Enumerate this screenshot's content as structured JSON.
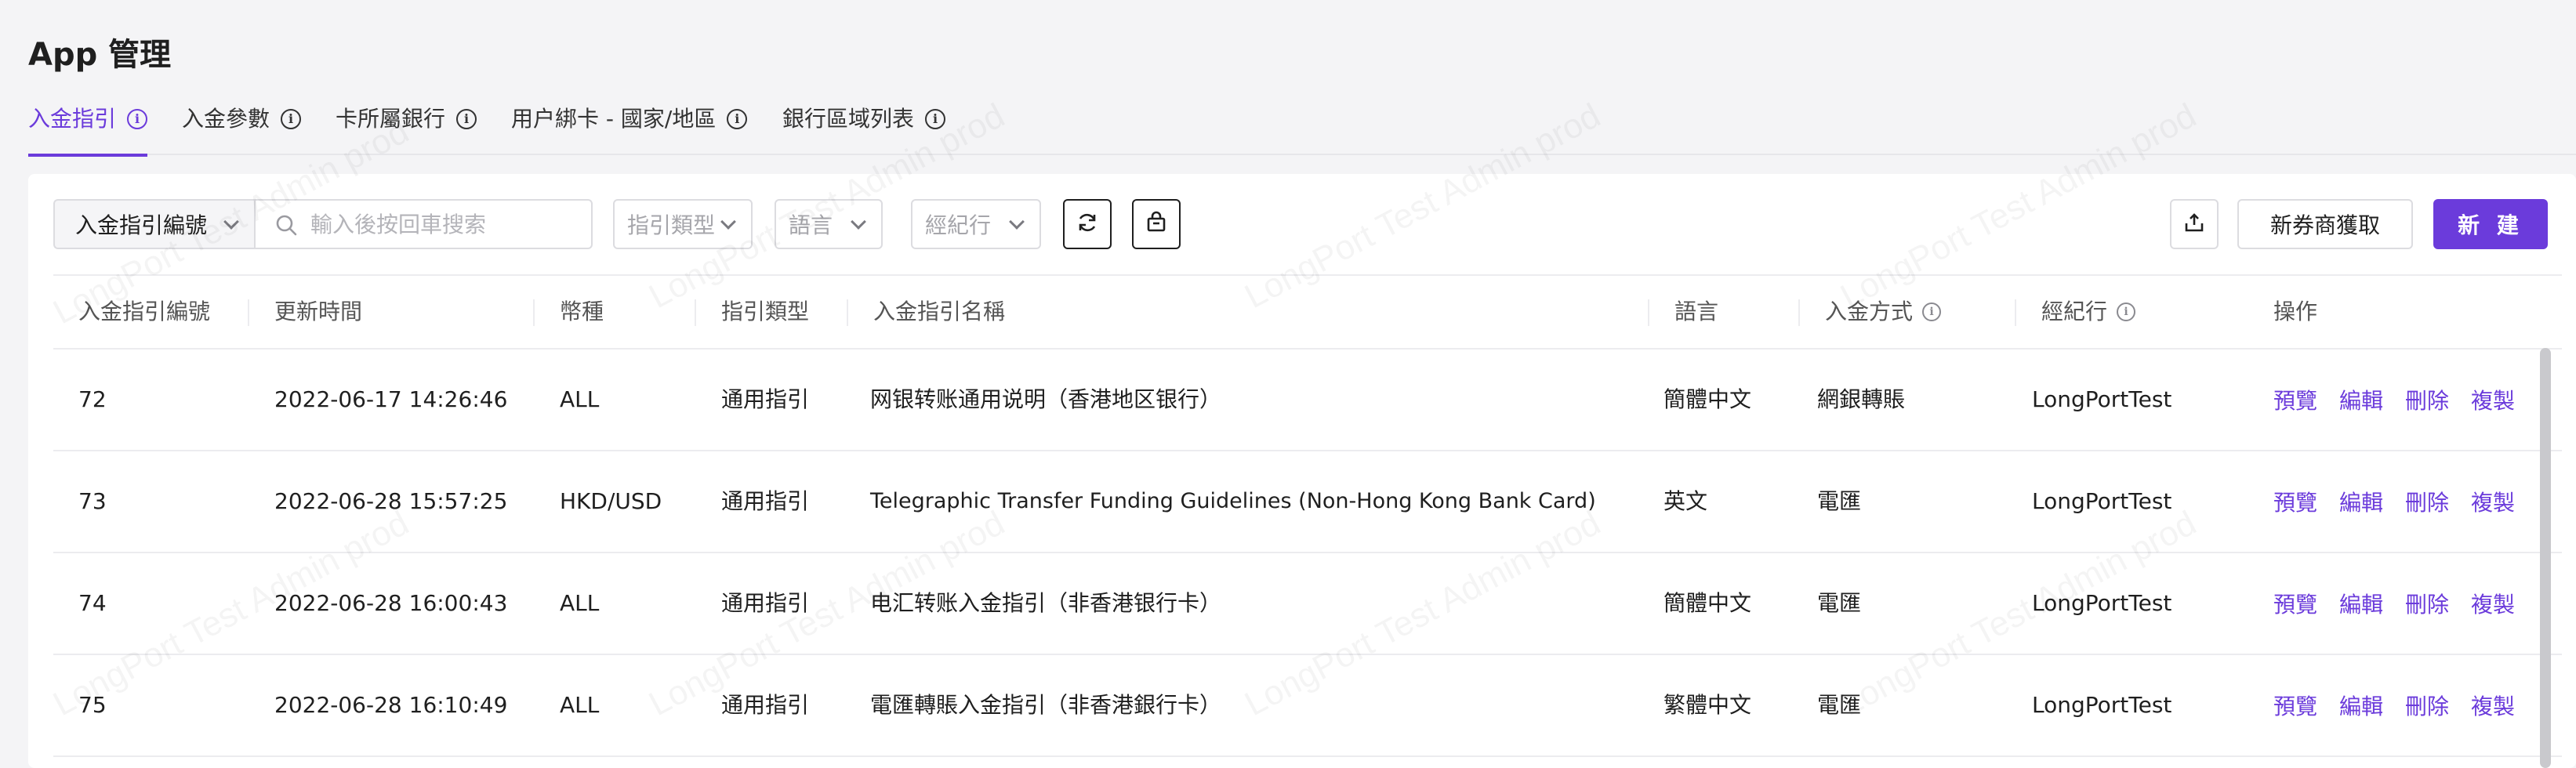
{
  "page": {
    "title": "App 管理"
  },
  "tabs": [
    {
      "label": "入金指引",
      "active": true
    },
    {
      "label": "入金參數",
      "active": false
    },
    {
      "label": "卡所屬銀行",
      "active": false
    },
    {
      "label": "用户綁卡 - 國家/地區",
      "active": false
    },
    {
      "label": "銀行區域列表",
      "active": false
    }
  ],
  "toolbar": {
    "search_field_selected": "入金指引編號",
    "search_placeholder": "輸入後按回車搜索",
    "filter_type": "指引類型",
    "filter_language": "語言",
    "filter_broker": "經紀行",
    "icons": [
      "refresh-icon",
      "basket-icon",
      "export-icon"
    ],
    "get_from_broker_label": "新券商獲取",
    "new_label": "新 建"
  },
  "table": {
    "headers": [
      "入金指引編號",
      "更新時間",
      "幣種",
      "指引類型",
      "入金指引名稱",
      "語言",
      "入金方式",
      "經紀行",
      "操作"
    ],
    "rows": [
      [
        "72",
        "2022-06-17 14:26:46",
        "ALL",
        "通用指引",
        "网银转账通用说明（香港地区银行）",
        "簡體中文",
        "網銀轉賬",
        "LongPortTest"
      ],
      [
        "73",
        "2022-06-28 15:57:25",
        "HKD/USD",
        "通用指引",
        "Telegraphic Transfer Funding Guidelines (Non-Hong Kong Bank Card)",
        "英文",
        "電匯",
        "LongPortTest"
      ],
      [
        "74",
        "2022-06-28 16:00:43",
        "ALL",
        "通用指引",
        "电汇转账入金指引（非香港银行卡）",
        "簡體中文",
        "電匯",
        "LongPortTest"
      ],
      [
        "75",
        "2022-06-28 16:10:49",
        "ALL",
        "通用指引",
        "電匯轉賬入金指引（非香港銀行卡）",
        "繁體中文",
        "電匯",
        "LongPortTest"
      ]
    ],
    "actions": [
      "預覽",
      "編輯",
      "刪除",
      "複製"
    ]
  },
  "watermark": {
    "text": "LongPort Test Admin prod"
  },
  "colors": {
    "accent": "#6b3bdb",
    "background": "#f4f4f6",
    "card": "#ffffff"
  }
}
